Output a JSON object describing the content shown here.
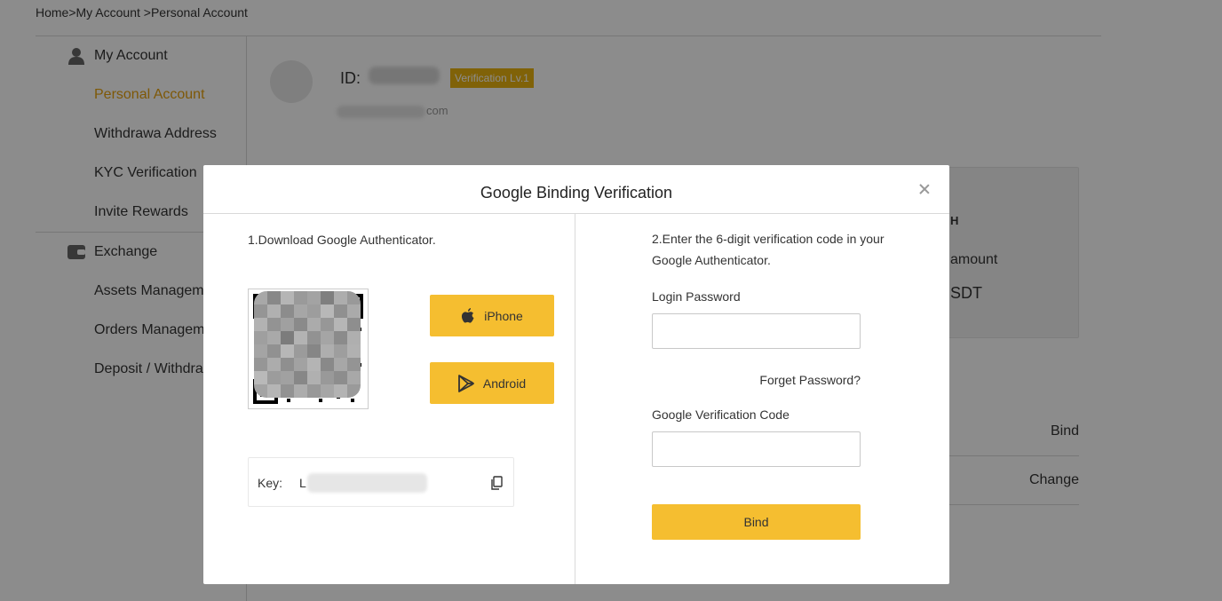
{
  "breadcrumb": {
    "text": "Home>My Account >Personal Account"
  },
  "sidebar": {
    "groups": [
      {
        "label": "My Account",
        "icon": "user-icon",
        "items": [
          {
            "label": "Personal Account",
            "active": true
          },
          {
            "label": "Withdrawa Address",
            "active": false
          },
          {
            "label": "KYC Verification",
            "active": false
          },
          {
            "label": "Invite Rewards",
            "active": false
          }
        ]
      },
      {
        "label": "Exchange",
        "icon": "wallet-icon",
        "items": [
          {
            "label": "Assets Managem",
            "active": false
          },
          {
            "label": "Orders Managem",
            "active": false
          },
          {
            "label": "Deposit / Withdra",
            "active": false
          }
        ]
      }
    ]
  },
  "profile": {
    "id_label": "ID:",
    "verification_badge": "Verification Lv.1",
    "email_suffix": "com"
  },
  "asset_card": {
    "heading_fragment": "H",
    "amount_label": "amount",
    "currency": "SDT"
  },
  "security_rows": [
    {
      "action": "Bind"
    },
    {
      "action": "Change"
    }
  ],
  "modal": {
    "title": "Google Binding Verification",
    "step1": "1.Download Google Authenticator.",
    "iphone_label": "iPhone",
    "android_label": "Android",
    "key_label": "Key:",
    "key_value": "L",
    "step2": "2.Enter the 6-digit verification code in your Google Authenticator.",
    "login_password_label": "Login Password",
    "login_password_value": "",
    "forget_password": "Forget Password?",
    "google_code_label": "Google Verification Code",
    "google_code_value": "",
    "bind_button": "Bind"
  },
  "colors": {
    "accent": "#f5be30",
    "badge": "#e9b20f",
    "active_nav": "#e6a10e",
    "overlay": "rgba(0,0,0,0.45)"
  }
}
